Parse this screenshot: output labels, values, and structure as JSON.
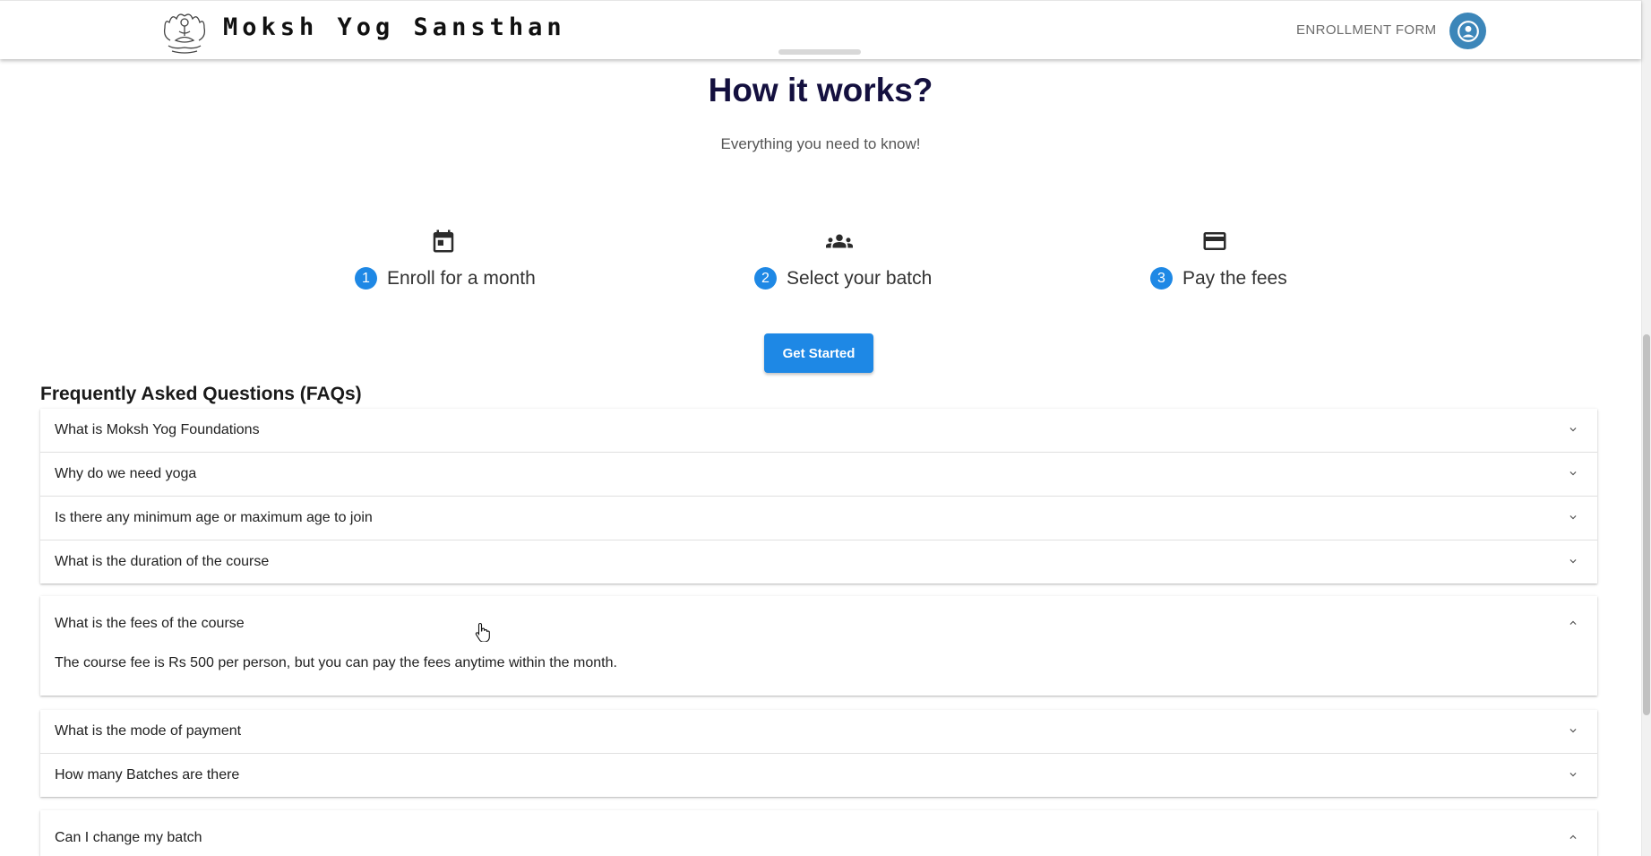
{
  "header": {
    "brand": "Moksh Yog Sansthan",
    "nav_enrollment": "ENROLLMENT FORM",
    "logo_icon": "lotus-meditation-icon",
    "avatar_icon": "account-circle-icon"
  },
  "hero": {
    "title": "How it works?",
    "subtitle": "Everything you need to know!"
  },
  "steps": [
    {
      "num": "1",
      "label": "Enroll for a month",
      "icon": "calendar-icon"
    },
    {
      "num": "2",
      "label": "Select your batch",
      "icon": "group-icon"
    },
    {
      "num": "3",
      "label": "Pay the fees",
      "icon": "credit-card-icon"
    }
  ],
  "cta": {
    "label": "Get Started"
  },
  "faq": {
    "title": "Frequently Asked Questions (FAQs)",
    "items": [
      {
        "question": "What is Moksh Yog Foundations",
        "expanded": false
      },
      {
        "question": "Why do we need yoga",
        "expanded": false
      },
      {
        "question": "Is there any minimum age or maximum age to join",
        "expanded": false
      },
      {
        "question": "What is the duration of the course",
        "expanded": false
      },
      {
        "question": "What is the fees of the course",
        "expanded": true,
        "answer": "The course fee is Rs 500 per person, but you can pay the fees anytime within the month."
      },
      {
        "question": "What is the mode of payment",
        "expanded": false
      },
      {
        "question": "How many Batches are there",
        "expanded": false
      },
      {
        "question": "Can I change my batch",
        "expanded": true
      }
    ]
  },
  "colors": {
    "primary": "#1e88e5",
    "title": "#14103f",
    "avatar": "#3c86b9"
  }
}
